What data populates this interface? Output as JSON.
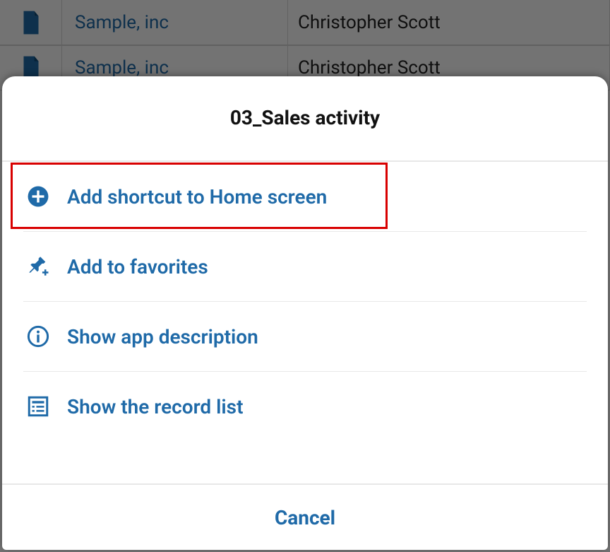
{
  "background": {
    "rows": [
      {
        "company": "Sample, inc",
        "contact": "Christopher Scott"
      },
      {
        "company": "Sample, inc",
        "contact": "Christopher Scott"
      }
    ]
  },
  "sheet": {
    "title": "03_Sales activity",
    "items": [
      {
        "label": "Add shortcut to Home screen"
      },
      {
        "label": "Add to favorites"
      },
      {
        "label": "Show app description"
      },
      {
        "label": "Show the record list"
      }
    ],
    "cancel": "Cancel"
  },
  "colors": {
    "accent": "#1f6aa8",
    "highlight": "#d80000"
  }
}
